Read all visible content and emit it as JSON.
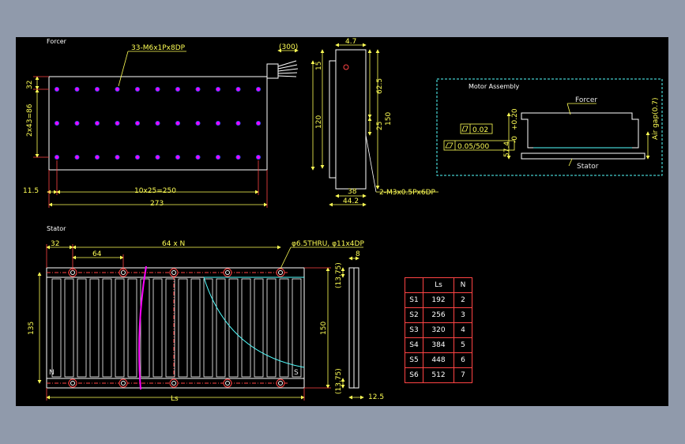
{
  "colors": {
    "background": "#000000",
    "frame": "#909aab",
    "outline": "#ffffff",
    "dimension": "#ffff55",
    "extension": "#ff4444",
    "cyan": "#55ffff",
    "magenta": "#ff00ff"
  },
  "forcer": {
    "title": "Forcer",
    "hole_callout": "33-M6x1Px8DP",
    "cable_length": "(300)",
    "dim_top": "32",
    "dim_pitch_v": "2x43=86",
    "dim_left": "11.5",
    "dim_pitch_h": "10x25=250",
    "dim_total": "273"
  },
  "side": {
    "dim_top_width": "4.7",
    "dim_15": "15",
    "dim_120": "120",
    "dim_62_5": "62.5",
    "dim_25": "25",
    "dim_150": "150",
    "dim_38": "38",
    "dim_44_2": "44.2",
    "hole_callout": "2-M3x0.5Px6DP"
  },
  "motor_assembly": {
    "title": "Motor Assembly",
    "forcer_label": "Forcer",
    "stator_label": "Stator",
    "air_gap": "Air gap(0.7)",
    "height": "57.4",
    "tolerance_up": "+0.20",
    "tolerance_down": "-0",
    "flatness_value": "0.02",
    "parallel_value": "0.05/500"
  },
  "stator": {
    "title": "Stator",
    "dim_32": "32",
    "dim_64xN": "64 x N",
    "dim_64": "64",
    "hole_callout": "φ6.5THRU, φ11x4DP",
    "dim_8": "8",
    "dim_135": "135",
    "dim_150": "150",
    "dim_13_75_top": "(13.75)",
    "dim_13_75_bottom": "(13.75)",
    "dim_12_5": "12.5",
    "dim_ls": "Ls",
    "pole_n": "N",
    "pole_s": "S"
  },
  "table": {
    "headers": [
      "",
      "Ls",
      "N"
    ],
    "rows": [
      [
        "S1",
        "192",
        "2"
      ],
      [
        "S2",
        "256",
        "3"
      ],
      [
        "S3",
        "320",
        "4"
      ],
      [
        "S4",
        "384",
        "5"
      ],
      [
        "S5",
        "448",
        "6"
      ],
      [
        "S6",
        "512",
        "7"
      ]
    ]
  }
}
